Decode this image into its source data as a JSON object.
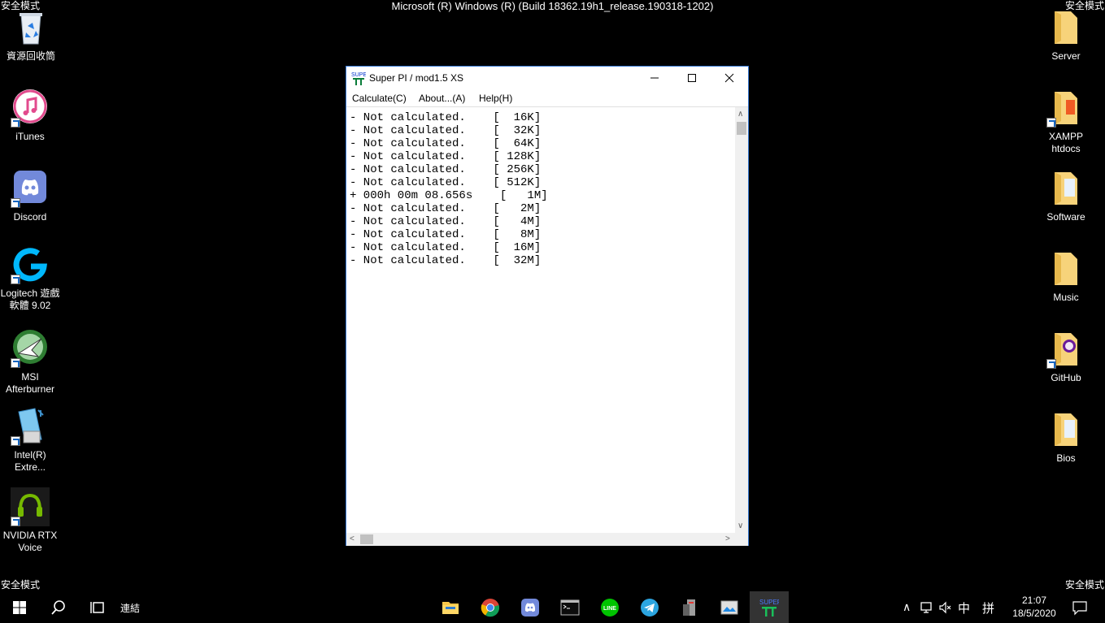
{
  "safe_mode_label": "安全模式",
  "build_text": "Microsoft (R) Windows (R) (Build 18362.19h1_release.190318-1202)",
  "desktop_left": [
    {
      "label": "資源回收筒",
      "icon": "recycle-bin-icon"
    },
    {
      "label": "iTunes",
      "icon": "itunes-icon"
    },
    {
      "label": "Discord",
      "icon": "discord-icon"
    },
    {
      "label": "Logitech 遊戲軟體 9.02",
      "icon": "logitech-icon"
    },
    {
      "label": "MSI Afterburner",
      "icon": "msi-afterburner-icon"
    },
    {
      "label": "Intel(R) Extre...",
      "icon": "intel-xtu-icon"
    },
    {
      "label": "NVIDIA RTX Voice",
      "icon": "nvidia-rtx-voice-icon"
    }
  ],
  "desktop_right": [
    {
      "label": "Server",
      "icon": "folder-icon"
    },
    {
      "label": "XAMPP htdocs",
      "icon": "folder-shortcut-icon"
    },
    {
      "label": "Software",
      "icon": "folder-icon"
    },
    {
      "label": "Music",
      "icon": "folder-icon"
    },
    {
      "label": "GitHub",
      "icon": "folder-github-icon"
    },
    {
      "label": "Bios",
      "icon": "folder-icon"
    }
  ],
  "window": {
    "title": "Super PI / mod1.5 XS",
    "menu": [
      "Calculate(C)",
      "About...(A)",
      "Help(H)"
    ],
    "output": "- Not calculated.    [  16K]\n- Not calculated.    [  32K]\n- Not calculated.    [  64K]\n- Not calculated.    [ 128K]\n- Not calculated.    [ 256K]\n- Not calculated.    [ 512K]\n+ 000h 00m 08.656s    [   1M]\n- Not calculated.    [   2M]\n- Not calculated.    [   4M]\n- Not calculated.    [   8M]\n- Not calculated.    [  16M]\n- Not calculated.    [  32M]"
  },
  "taskbar": {
    "task_view_label": "連結",
    "apps": [
      "file-explorer-icon",
      "chrome-icon",
      "discord-icon",
      "terminal-icon",
      "line-icon",
      "telegram-icon",
      "tool-icon",
      "image-app-icon",
      "superpi-icon"
    ],
    "ime_lang": "中",
    "ime_mode": "拼",
    "time": "21:07",
    "date": "18/5/2020"
  },
  "colors": {
    "window_border": "#3a7bd5",
    "desktop": "#000000"
  }
}
